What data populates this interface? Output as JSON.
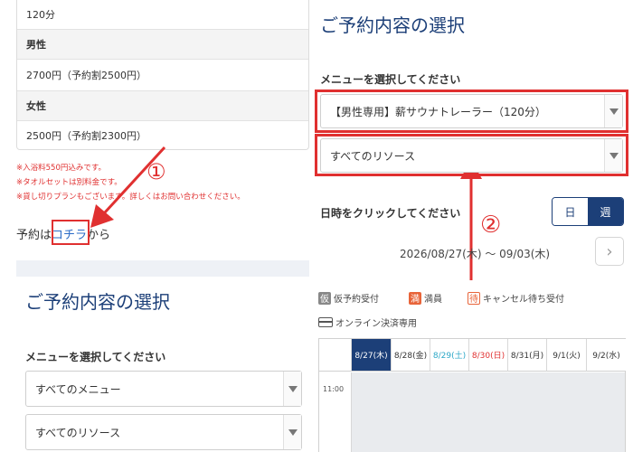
{
  "left": {
    "duration": "120分",
    "male_head": "男性",
    "male_price": "2700円（予約割2500円）",
    "female_head": "女性",
    "female_price": "2500円（予約割2300円）",
    "notes": [
      "※入浴料550円込みです。",
      "※タオルセットは別料金です。",
      "※貸し切りプランもございます。詳しくはお問い合わせください。"
    ],
    "reserve_prefix": "予約は",
    "reserve_link": "コチラ",
    "reserve_suffix": "から",
    "section_title": "ご予約内容の選択",
    "menu_label": "メニューを選択してください",
    "menu_select": "すべてのメニュー",
    "resource_select": "すべてのリソース"
  },
  "annotations": {
    "marker_1": "①",
    "marker_2": "②",
    "accent_color": "#e03030"
  },
  "right": {
    "section_title": "ご予約内容の選択",
    "menu_label": "メニューを選択してください",
    "menu_select": "【男性専用】薪サウナトレーラー（120分）",
    "resource_select": "すべてのリソース",
    "datetime_label": "日時をクリックしてください",
    "view_day": "日",
    "view_week": "週",
    "date_range": "2026/08/27(木) 〜 09/03(木)",
    "next_icon": "›",
    "legend": {
      "tentative_badge": "仮",
      "tentative_label": "仮予約受付",
      "full_badge": "満",
      "full_label": "満員",
      "wait_badge": "待",
      "wait_label": "キャンセル待ち受付",
      "online_label": "オンライン決済専用"
    },
    "calendar": {
      "days": [
        {
          "label": "8/27(木)",
          "color": "#ffffff"
        },
        {
          "label": "8/28(金)",
          "color": "#333333"
        },
        {
          "label": "8/29(土)",
          "color": "#2aa7c7"
        },
        {
          "label": "8/30(日)",
          "color": "#e03030"
        },
        {
          "label": "8/31(月)",
          "color": "#333333"
        },
        {
          "label": "9/1(火)",
          "color": "#333333"
        },
        {
          "label": "9/2(水)",
          "color": "#333333"
        }
      ],
      "first_time": "11:00"
    }
  }
}
